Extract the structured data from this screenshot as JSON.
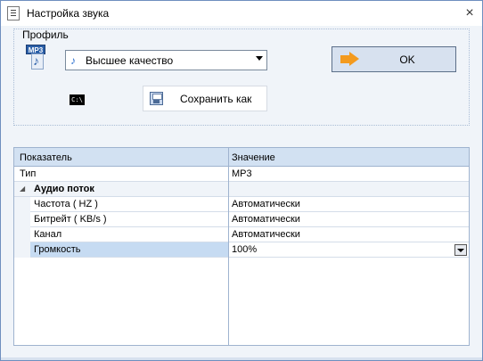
{
  "window": {
    "title": "Настройка звука",
    "close_glyph": "×"
  },
  "profile": {
    "group_label": "Профиль",
    "icon": "mp3-file-icon",
    "mp3_tag": "MP3",
    "selected": "Высшее качество",
    "cmd_icon_text": "C:\\"
  },
  "buttons": {
    "ok": "OK",
    "save_as": "Сохранить как"
  },
  "grid": {
    "headers": [
      "Показатель",
      "Значение"
    ],
    "rows": [
      {
        "name": "Тип",
        "value": "MP3",
        "indent": 0
      },
      {
        "category": "Аудио поток"
      },
      {
        "name": "Частота ( HZ )",
        "value": "Автоматически",
        "indent": 1
      },
      {
        "name": "Битрейт ( KB/s )",
        "value": "Автоматически",
        "indent": 1
      },
      {
        "name": "Канал",
        "value": "Автоматически",
        "indent": 1
      },
      {
        "name": "Громкость",
        "value": "100%",
        "indent": 1,
        "selected": true
      }
    ]
  },
  "colors": {
    "accent": "#f39a1e",
    "header_bg": "#d2e1f2",
    "selection": "#c6dbf2"
  }
}
